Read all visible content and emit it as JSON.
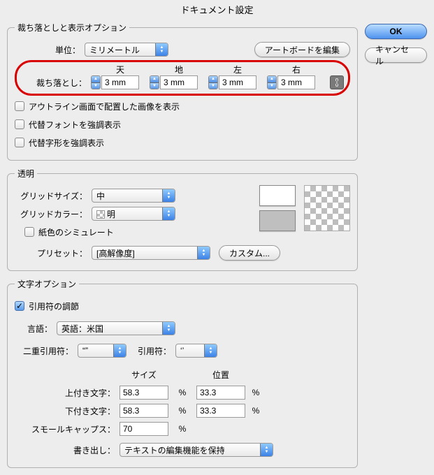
{
  "title": "ドキュメント設定",
  "buttons": {
    "ok": "OK",
    "cancel": "キャンセル",
    "edit_artboards": "アートボードを編集",
    "custom": "カスタム..."
  },
  "section1": {
    "legend": "裁ち落としと表示オプション",
    "unit_label": "単位：",
    "unit_value": "ミリメートル",
    "bleed_label": "裁ち落とし：",
    "headers": {
      "top": "天",
      "bottom": "地",
      "left": "左",
      "right": "右"
    },
    "bleed": {
      "top": "3 mm",
      "bottom": "3 mm",
      "left": "3 mm",
      "right": "3 mm"
    },
    "cb1": "アウトライン画面で配置した画像を表示",
    "cb2": "代替フォントを強調表示",
    "cb3": "代替字形を強調表示"
  },
  "section2": {
    "legend": "透明",
    "grid_size_label": "グリッドサイズ：",
    "grid_size_value": "中",
    "grid_color_label": "グリッドカラー：",
    "grid_color_value": "明",
    "simulate_paper": "紙色のシミュレート",
    "preset_label": "プリセット：",
    "preset_value": "[高解像度]"
  },
  "section3": {
    "legend": "文字オプション",
    "quote_adjust": "引用符の調節",
    "lang_label": "言語：",
    "lang_value": "英語：米国",
    "dquote_label": "二重引用符：",
    "dquote_value": "“”",
    "squote_label": "引用符：",
    "squote_value": "‘’",
    "size_hdr": "サイズ",
    "pos_hdr": "位置",
    "pct": "%",
    "sup_label": "上付き文字：",
    "sup_size": "58.3",
    "sup_pos": "33.3",
    "sub_label": "下付き文字：",
    "sub_size": "58.3",
    "sub_pos": "33.3",
    "smallcaps_label": "スモールキャップス：",
    "smallcaps_value": "70",
    "export_label": "書き出し：",
    "export_value": "テキストの編集機能を保持"
  }
}
